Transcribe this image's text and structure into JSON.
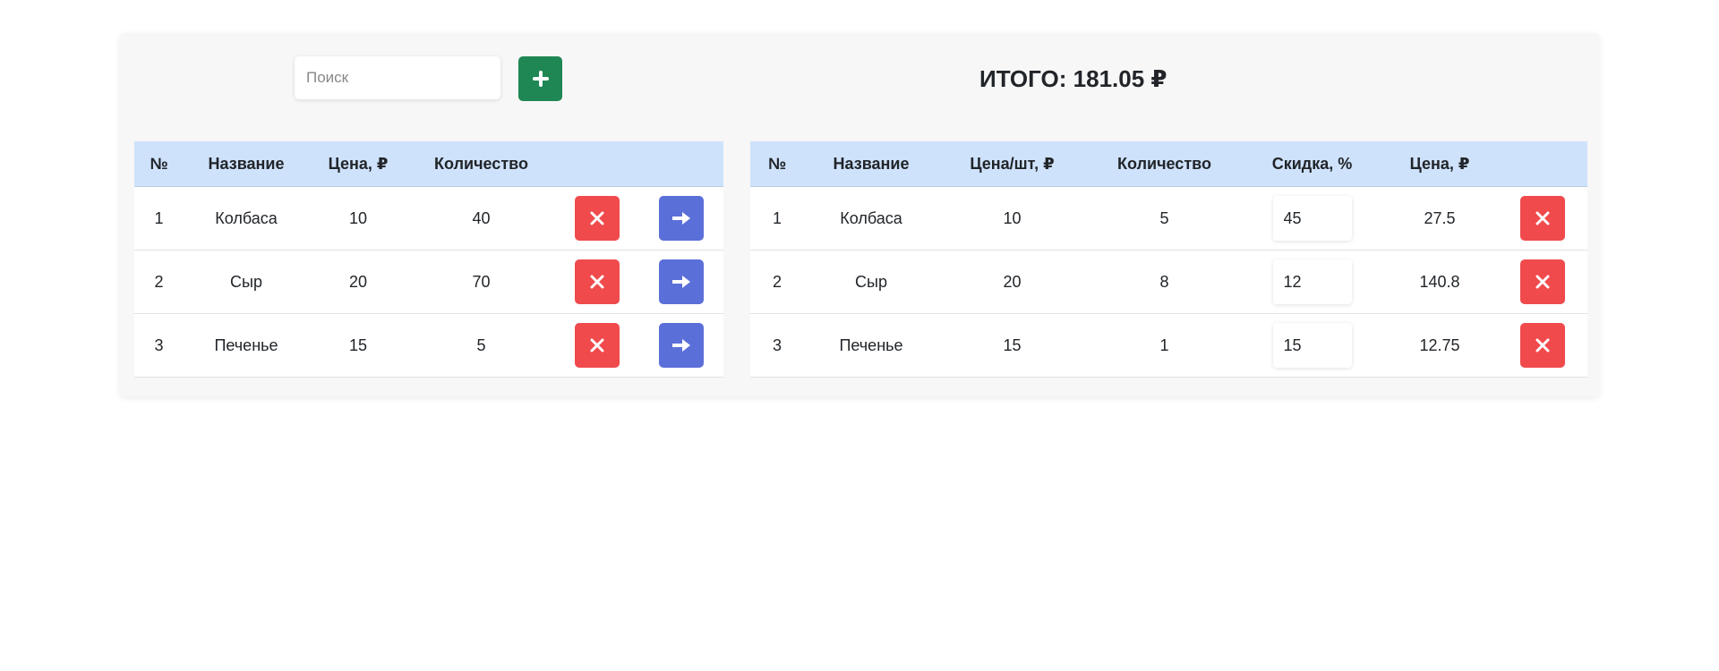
{
  "search": {
    "placeholder": "Поиск"
  },
  "icons": {
    "add": "plus-icon",
    "delete": "close-icon",
    "move": "arrow-right-icon"
  },
  "colors": {
    "add_button": "#1e8754",
    "delete_button": "#f04a4d",
    "move_button": "#5b6fd9",
    "table_header": "#cfe2fc"
  },
  "total_label": "ИТОГО: 181.05 ₽",
  "products": {
    "headers": [
      "№",
      "Название",
      "Цена, ₽",
      "Количество"
    ],
    "rows": [
      {
        "num": "1",
        "name": "Колбаса",
        "price": "10",
        "qty": "40"
      },
      {
        "num": "2",
        "name": "Сыр",
        "price": "20",
        "qty": "70"
      },
      {
        "num": "3",
        "name": "Печенье",
        "price": "15",
        "qty": "5"
      }
    ]
  },
  "cart": {
    "headers": [
      "№",
      "Название",
      "Цена/шт, ₽",
      "Количество",
      "Скидка, %",
      "Цена, ₽"
    ],
    "rows": [
      {
        "num": "1",
        "name": "Колбаса",
        "unit_price": "10",
        "qty": "5",
        "discount": "45",
        "price": "27.5"
      },
      {
        "num": "2",
        "name": "Сыр",
        "unit_price": "20",
        "qty": "8",
        "discount": "12",
        "price": "140.8"
      },
      {
        "num": "3",
        "name": "Печенье",
        "unit_price": "15",
        "qty": "1",
        "discount": "15",
        "price": "12.75"
      }
    ]
  }
}
